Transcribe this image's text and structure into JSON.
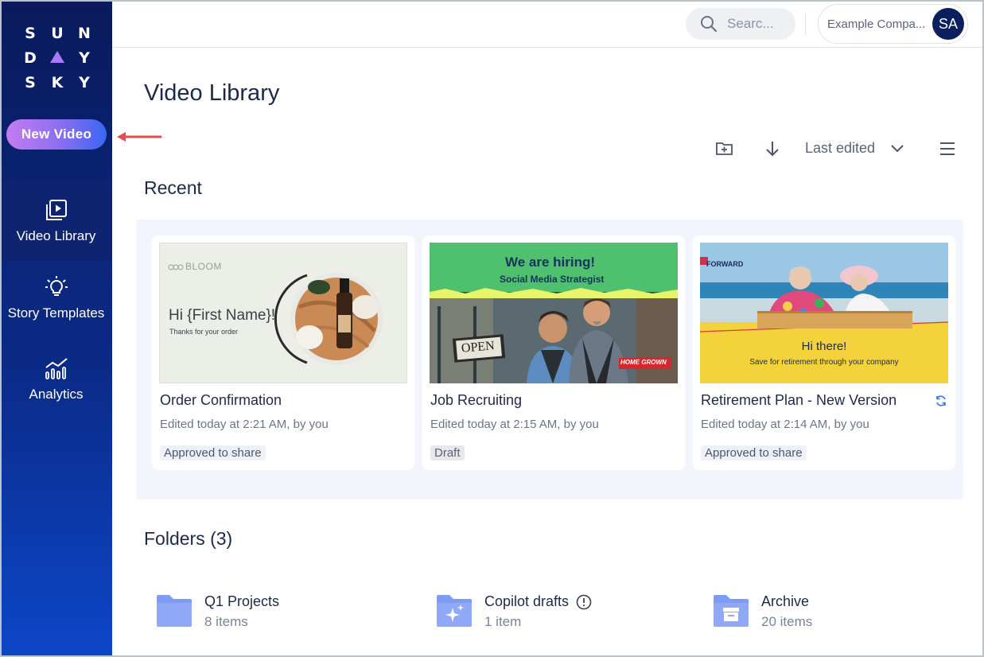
{
  "sidebar": {
    "logo_letters": [
      [
        "S",
        "U",
        "N"
      ],
      [
        "D",
        "",
        "Y"
      ],
      [
        "S",
        "K",
        "Y"
      ]
    ],
    "new_video_label": "New Video",
    "nav": [
      {
        "label": "Video Library",
        "icon": "video-library-icon",
        "active": true
      },
      {
        "label": "Story Templates",
        "icon": "lightbulb-icon",
        "active": false
      },
      {
        "label": "Analytics",
        "icon": "analytics-icon",
        "active": false
      }
    ]
  },
  "topbar": {
    "search_placeholder": "Searc...",
    "company_name": "Example Compa...",
    "avatar_initials": "SA"
  },
  "main": {
    "title": "Video Library",
    "sort_label": "Last edited",
    "recent_title": "Recent",
    "folders_title": "Folders (3)"
  },
  "cards": [
    {
      "title": "Order Confirmation",
      "edited": "Edited today at 2:21 AM, by you",
      "status": "Approved to share",
      "thumb": {
        "brand": "BLOOM",
        "headline": "Hi {First Name}!",
        "sub": "Thanks for your order"
      }
    },
    {
      "title": "Job Recruiting",
      "edited": "Edited today at 2:15 AM, by you",
      "status": "Draft",
      "thumb": {
        "headline": "We are hiring!",
        "sub": "Social Media Strategist",
        "sign": "OPEN",
        "tag": "HOME GROWN"
      }
    },
    {
      "title": "Retirement Plan - New Version",
      "edited": "Edited today at 2:14 AM, by you",
      "status": "Approved to share",
      "thumb": {
        "brand": "FORWARD",
        "headline": "Hi there!",
        "sub": "Save for retirement through your company"
      }
    }
  ],
  "folders": [
    {
      "name": "Q1 Projects",
      "count": "8 items",
      "icon": "folder-icon"
    },
    {
      "name": "Copilot drafts",
      "count": "1 item",
      "icon": "copilot-folder-icon"
    },
    {
      "name": "Archive",
      "count": "20 items",
      "icon": "archive-folder-icon"
    }
  ],
  "colors": {
    "sidebar_top": "#0a1a5c",
    "sidebar_bottom": "#0c46c8",
    "accent_purple": "#a77bff",
    "folder_blue": "#7f9cf5",
    "arrow_red": "#e84b4b"
  }
}
